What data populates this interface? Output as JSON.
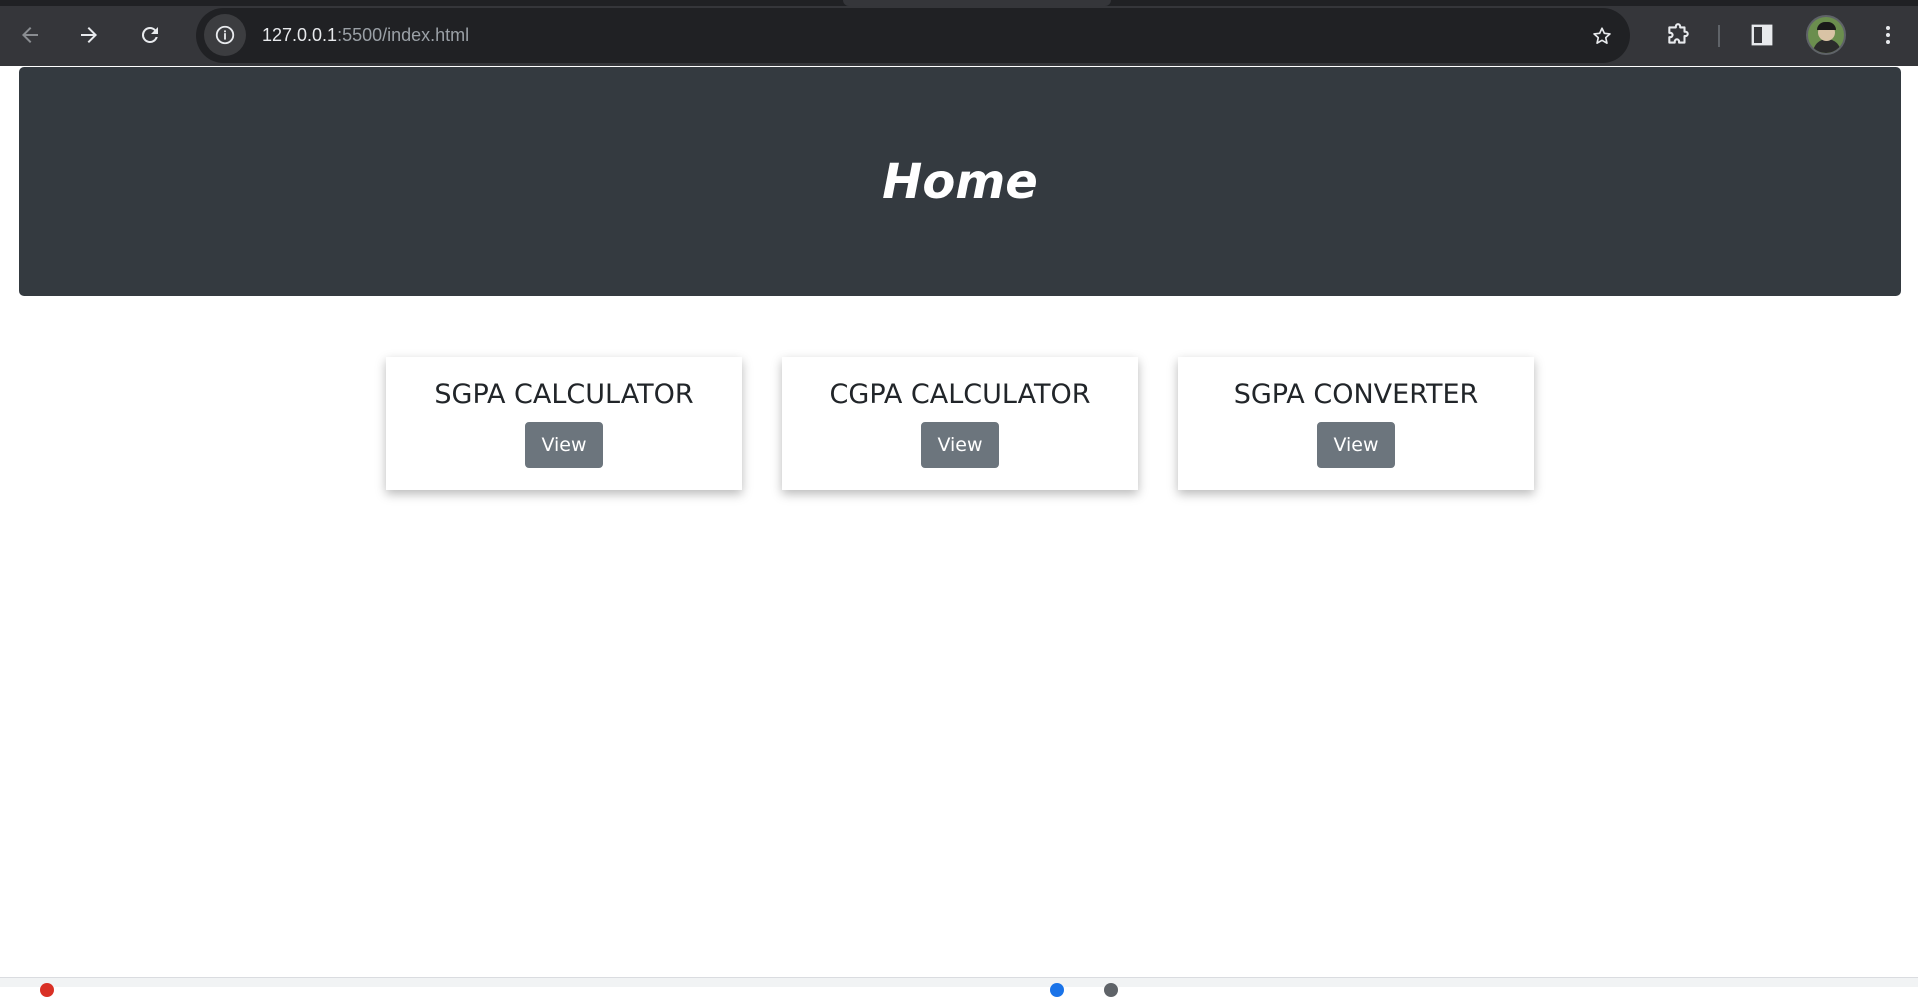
{
  "browser": {
    "url_host": "127.0.0.1",
    "url_rest": ":5500/index.html",
    "icons": {
      "back": "back-arrow-icon",
      "forward": "forward-arrow-icon",
      "reload": "reload-icon",
      "site_info": "info-icon",
      "bookmark": "star-icon",
      "extensions": "puzzle-icon",
      "side_panel": "side-panel-icon",
      "profile": "avatar",
      "menu": "kebab-menu-icon"
    }
  },
  "hero": {
    "title": "Home"
  },
  "cards": [
    {
      "title": "SGPA CALCULATOR",
      "button_label": "View"
    },
    {
      "title": "CGPA CALCULATOR",
      "button_label": "View"
    },
    {
      "title": "SGPA CONVERTER",
      "button_label": "View"
    }
  ],
  "colors": {
    "chrome_bg": "#35363a",
    "omnibox_bg": "#202124",
    "hero_bg": "#343a40",
    "button_bg": "#6c757d",
    "card_text": "#212529"
  }
}
